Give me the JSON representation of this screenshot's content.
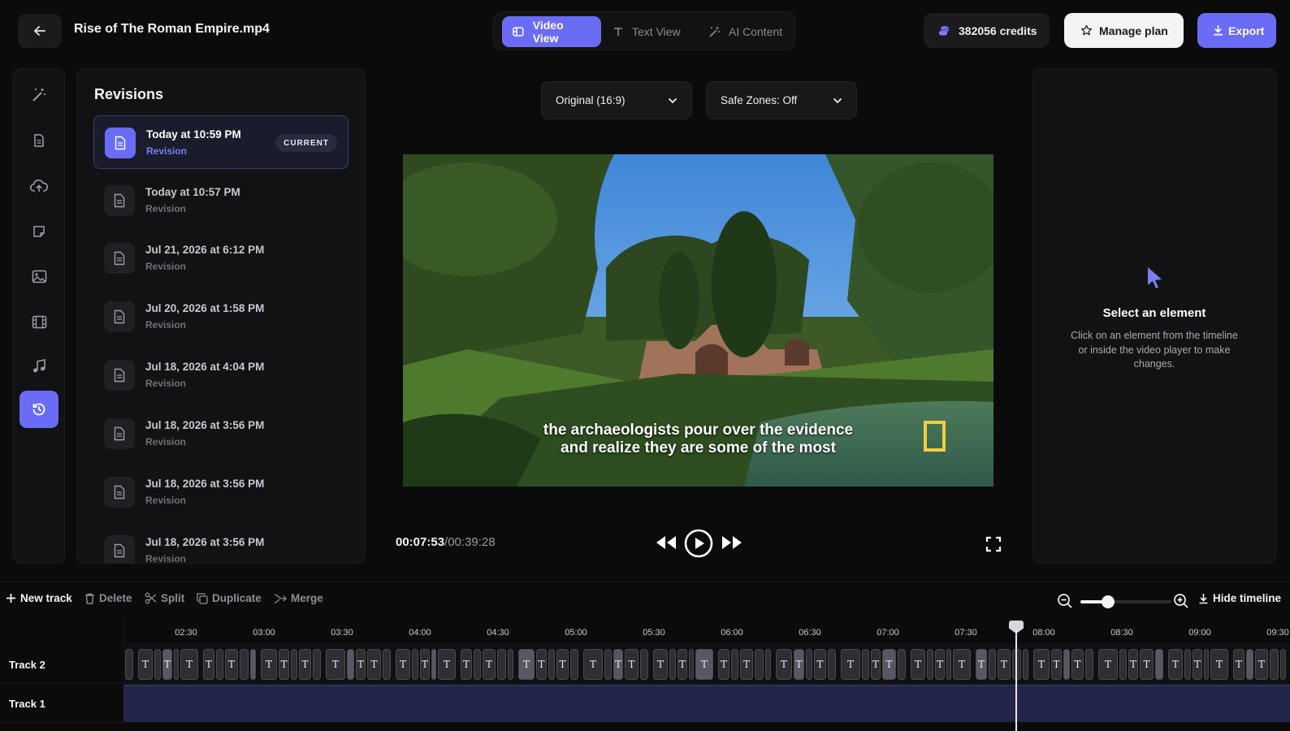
{
  "header": {
    "title": "Rise of The Roman Empire.mp4",
    "tabs": [
      {
        "label": "Video View",
        "active": true
      },
      {
        "label": "Text View",
        "active": false
      },
      {
        "label": "AI Content",
        "active": false
      }
    ],
    "credits": "382056 credits",
    "manage_label": "Manage plan",
    "export_label": "Export"
  },
  "rail": {
    "items": [
      "magic-wand-icon",
      "document-icon",
      "upload-cloud-icon",
      "note-icon",
      "image-icon",
      "film-icon",
      "music-icon",
      "history-icon"
    ],
    "active": "history-icon"
  },
  "revisions": {
    "title": "Revisions",
    "items": [
      {
        "date": "Today at 10:59 PM",
        "label": "Revision",
        "badge": "CURRENT"
      },
      {
        "date": "Today at 10:57 PM",
        "label": "Revision"
      },
      {
        "date": "Jul 21, 2026 at 6:12 PM",
        "label": "Revision"
      },
      {
        "date": "Jul 20, 2026 at 1:58 PM",
        "label": "Revision"
      },
      {
        "date": "Jul 18, 2026 at 4:04 PM",
        "label": "Revision"
      },
      {
        "date": "Jul 18, 2026 at 3:56 PM",
        "label": "Revision"
      },
      {
        "date": "Jul 18, 2026 at 3:56 PM",
        "label": "Revision"
      },
      {
        "date": "Jul 18, 2026 at 3:56 PM",
        "label": "Revision"
      }
    ]
  },
  "player": {
    "aspect_select": "Original (16:9)",
    "safe_zones_select": "Safe Zones: Off",
    "caption_line1": "the archaeologists pour over the evidence",
    "caption_line2": "and realize they are some of the most",
    "current_time": "00:07:53",
    "separator": "/",
    "duration": "00:39:28"
  },
  "properties": {
    "title": "Select an element",
    "description": "Click on an element from the timeline or inside the video player to make changes."
  },
  "timeline": {
    "tools": {
      "new_track": "New track",
      "delete": "Delete",
      "split": "Split",
      "duplicate": "Duplicate",
      "merge": "Merge",
      "hide": "Hide timeline"
    },
    "zoom_level": 0.3,
    "ticks": [
      "02:30",
      "03:00",
      "03:30",
      "04:00",
      "04:30",
      "05:00",
      "05:30",
      "06:00",
      "06:30",
      "07:00",
      "07:30",
      "08:00",
      "08:30",
      "09:00",
      "09:30"
    ],
    "tracks": [
      "Track 2",
      "Track 1"
    ],
    "clip_glyph": "T"
  },
  "colors": {
    "accent": "#6b6cf5",
    "background": "#0b0b0c",
    "panel": "#121214",
    "logo_yellow": "#f3cf3a"
  }
}
